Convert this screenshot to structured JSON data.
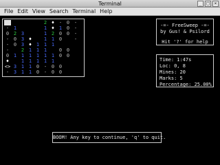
{
  "window": {
    "title": "Terminal",
    "buttons": [
      "_",
      "□",
      "×"
    ]
  },
  "menubar": {
    "items": [
      "File",
      "Edit",
      "View",
      "Search",
      "Terminal",
      "Help"
    ]
  },
  "board": {
    "rows": [
      [
        "#",
        "",
        "",
        "",
        "",
        "2",
        "♦",
        "-",
        "0",
        "-"
      ],
      [
        "-",
        "1",
        "",
        "",
        "",
        "1",
        "♦",
        "1",
        "0",
        "-"
      ],
      [
        "0",
        "2",
        "3",
        "",
        "",
        "1",
        "2",
        "0",
        "0",
        "-"
      ],
      [
        "-",
        "0",
        "3",
        "♦",
        "",
        "1",
        "1",
        "0",
        "",
        "-"
      ],
      [
        "-",
        "0",
        "3",
        "♦",
        "1",
        "1",
        "1",
        "",
        "",
        ""
      ],
      [
        "-",
        "",
        "2",
        "1",
        "1",
        "1",
        "",
        "0",
        "0",
        ""
      ],
      [
        "0",
        "1",
        "1",
        "1",
        "1",
        "1",
        "1",
        "0",
        "0",
        ""
      ],
      [
        "♦",
        "",
        "1",
        "1",
        "1",
        "1",
        "1",
        "",
        "",
        ""
      ],
      [
        "<>",
        "3",
        "1",
        "1",
        "0",
        "-",
        "0",
        "0",
        "",
        ""
      ],
      [
        "-",
        "3",
        "1",
        "1",
        "0",
        "-",
        "0",
        "0",
        "",
        ""
      ]
    ],
    "cursor": {
      "row": 0,
      "col": 0
    }
  },
  "brand": {
    "line1": "-=- FreeSweep -=-",
    "line2": "by Gus! & Psilord",
    "line3": "Hit '?' for help"
  },
  "stats": {
    "time": "Time: 1:47s",
    "loc": "Loc: 0, 8",
    "mines": "Mines: 20",
    "marks": "Marks: 5",
    "percentage": "Percentage: 25.00%"
  },
  "status": {
    "message": "BOOM! Any key to continue, 'q' to quit."
  },
  "colors": {
    "1": "#4a6cff",
    "2": "#2ecc40",
    "3": "#4a6cff",
    "0": "#bdbdbd",
    "-": "#bdbdbd",
    "♦": "#ffffff",
    "<>": "#ffffff",
    "#": "#000000",
    "": "#000000"
  }
}
